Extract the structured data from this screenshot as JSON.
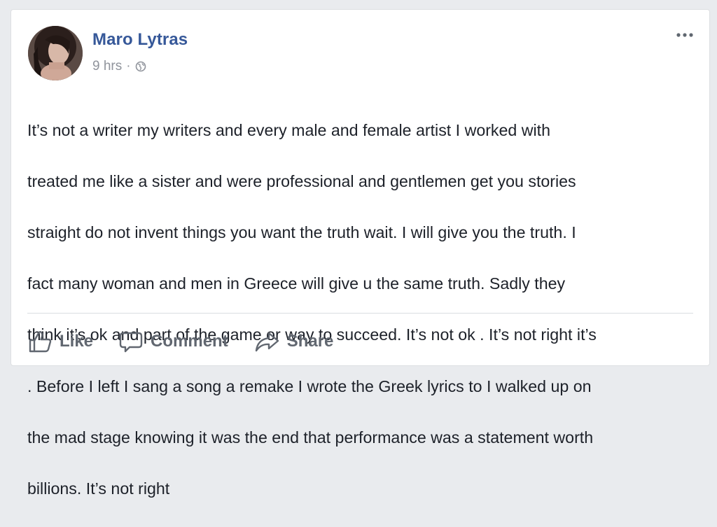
{
  "post": {
    "author": "Maro Lytras",
    "timestamp": "9 hrs",
    "separator": "·",
    "privacy_icon": "globe-icon",
    "menu_icon": "more-options-icon",
    "lines": [
      "It’s not a writer my writers and every male and female artist I worked with",
      "treated me like a sister and were professional and gentlemen get you stories",
      "straight do not invent things you want the truth wait. I will give you the truth. I",
      "fact many woman and men in Greece will give u the same truth. Sadly they",
      "think it’s ok and part of the game or way to succeed. It’s not ok . It’s not right it’s",
      ". Before I left I sang a song a remake I wrote the Greek lyrics to I walked up on",
      "the mad stage knowing it was the end that performance was a statement worth",
      "billions. It’s not right"
    ]
  },
  "actions": {
    "like": "Like",
    "comment": "Comment",
    "share": "Share"
  },
  "colors": {
    "author_link": "#365899",
    "meta_text": "#90949c",
    "body_text": "#1d2129",
    "action_text": "#616770",
    "background": "#e9ebee"
  }
}
